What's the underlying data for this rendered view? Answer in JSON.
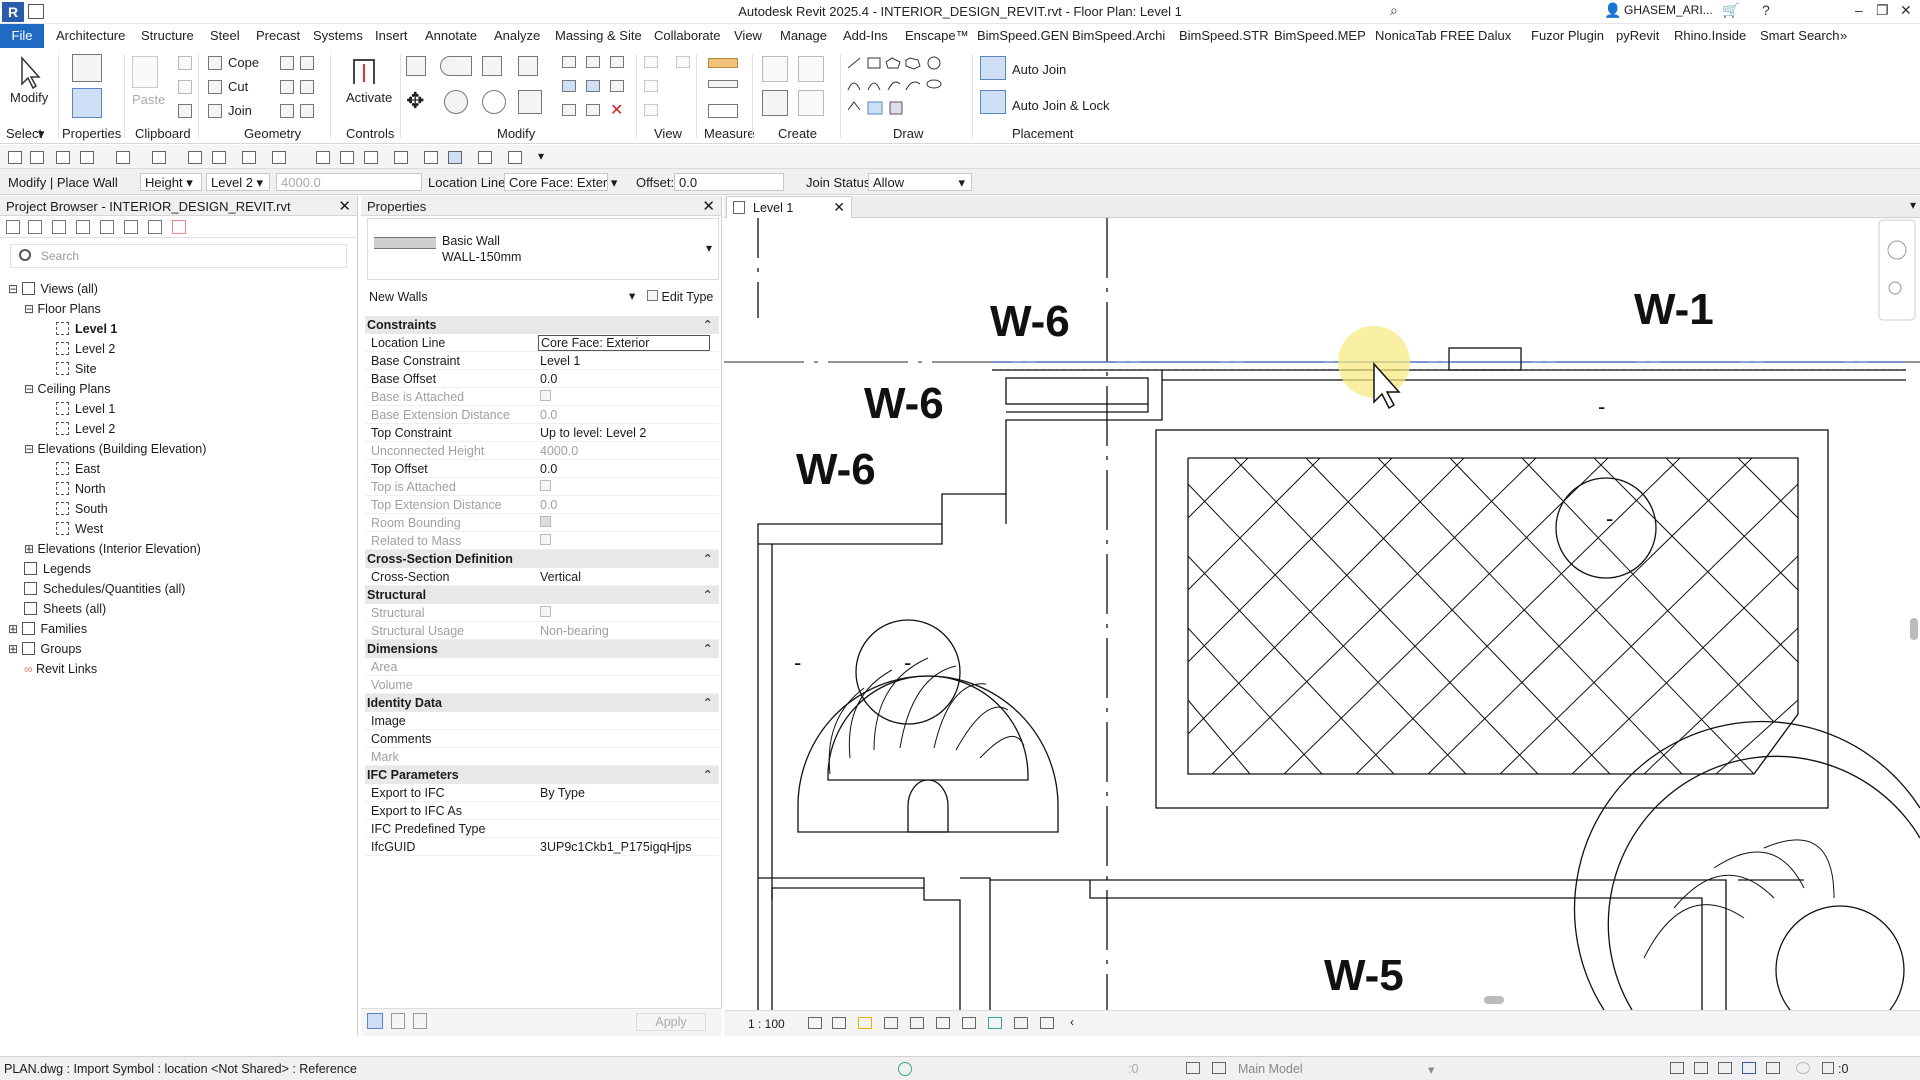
{
  "title_bar": {
    "app_icon": "R",
    "title": "Autodesk Revit 2025.4 - INTERIOR_DESIGN_REVIT.rvt - Floor Plan: Level 1",
    "user": "GHASEM_ARI..."
  },
  "menu": {
    "file": "File",
    "tabs": [
      "Architecture",
      "Structure",
      "Steel",
      "Precast",
      "Systems",
      "Insert",
      "Annotate",
      "Analyze",
      "Massing & Site",
      "Collaborate",
      "View",
      "Manage",
      "Add-Ins",
      "Enscape™",
      "BimSpeed.GEN",
      "BimSpeed.Archi",
      "BimSpeed.STR",
      "BimSpeed.MEP",
      "NonicaTab FREE",
      "Dalux",
      "Fuzor Plugin",
      "pyRevit",
      "Rhino.Inside",
      "Smart Search"
    ]
  },
  "ribbon": {
    "modify": "Modify",
    "paste": "Paste",
    "cope": "Cope",
    "cut": "Cut",
    "join": "Join",
    "activate": "Activate",
    "auto_join": "Auto Join",
    "auto_join_lock": "Auto Join & Lock",
    "groups": {
      "select": "Select",
      "properties": "Properties",
      "clipboard": "Clipboard",
      "geometry": "Geometry",
      "controls": "Controls",
      "modify": "Modify",
      "view": "View",
      "measure": "Measure",
      "create": "Create",
      "draw": "Draw",
      "placement": "Placement"
    }
  },
  "options_bar": {
    "context": "Modify | Place Wall",
    "height_mode": "Height",
    "level": "Level 2",
    "height_value": "4000.0",
    "location_line_label": "Location Line:",
    "location_line_value": "Core Face: Exter",
    "offset_label": "Offset:",
    "offset_value": "0.0",
    "join_status_label": "Join Status:",
    "join_status_value": "Allow"
  },
  "project_browser": {
    "title": "Project Browser - INTERIOR_DESIGN_REVIT.rvt",
    "search_placeholder": "Search",
    "views_all": "Views (all)",
    "floor_plans": "Floor Plans",
    "fp_level1": "Level 1",
    "fp_level2": "Level 2",
    "fp_site": "Site",
    "ceiling_plans": "Ceiling Plans",
    "cp_level1": "Level 1",
    "cp_level2": "Level 2",
    "elev_building": "Elevations (Building Elevation)",
    "east": "East",
    "north": "North",
    "south": "South",
    "west": "West",
    "elev_interior": "Elevations (Interior Elevation)",
    "legends": "Legends",
    "schedules": "Schedules/Quantities (all)",
    "sheets": "Sheets (all)",
    "families": "Families",
    "groups": "Groups",
    "revit_links": "Revit Links"
  },
  "properties": {
    "title": "Properties",
    "type_family": "Basic Wall",
    "type_name": "WALL-150mm",
    "instance_filter": "New Walls",
    "edit_type": "Edit Type",
    "sections": {
      "constraints": "Constraints",
      "cross_section_def": "Cross-Section Definition",
      "structural": "Structural",
      "dimensions": "Dimensions",
      "identity": "Identity Data",
      "ifc": "IFC Parameters"
    },
    "rows": {
      "location_line": [
        "Location Line",
        "Core Face: Exterior"
      ],
      "base_constraint": [
        "Base Constraint",
        "Level 1"
      ],
      "base_offset": [
        "Base Offset",
        "0.0"
      ],
      "base_attached": [
        "Base is Attached",
        ""
      ],
      "base_ext": [
        "Base Extension Distance",
        "0.0"
      ],
      "top_constraint": [
        "Top Constraint",
        "Up to level: Level 2"
      ],
      "unconnected": [
        "Unconnected Height",
        "4000.0"
      ],
      "top_offset": [
        "Top Offset",
        "0.0"
      ],
      "top_attached": [
        "Top is Attached",
        ""
      ],
      "top_ext": [
        "Top Extension Distance",
        "0.0"
      ],
      "room_bounding": [
        "Room Bounding",
        ""
      ],
      "related_mass": [
        "Related to Mass",
        ""
      ],
      "cross_section": [
        "Cross-Section",
        "Vertical"
      ],
      "structural": [
        "Structural",
        ""
      ],
      "structural_usage": [
        "Structural Usage",
        "Non-bearing"
      ],
      "area": [
        "Area",
        ""
      ],
      "volume": [
        "Volume",
        ""
      ],
      "image": [
        "Image",
        ""
      ],
      "comments": [
        "Comments",
        ""
      ],
      "mark": [
        "Mark",
        ""
      ],
      "export_ifc": [
        "Export to IFC",
        "By Type"
      ],
      "export_ifc_as": [
        "Export to IFC As",
        ""
      ],
      "ifc_predefined": [
        "IFC Predefined Type",
        ""
      ],
      "ifcguid": [
        "IfcGUID",
        "3UP9c1Ckb1_P175igqHjps"
      ]
    },
    "apply": "Apply"
  },
  "view": {
    "tab": "Level 1",
    "scale": "1 : 100",
    "tags": [
      "W-6",
      "W-6",
      "W-6",
      "W-1",
      "W-5"
    ]
  },
  "status_bar": {
    "message": "PLAN.dwg : Import Symbol : location <Not Shared> : Reference",
    "selection_count": ":0",
    "model": "Main Model",
    "filter_count": ":0"
  }
}
